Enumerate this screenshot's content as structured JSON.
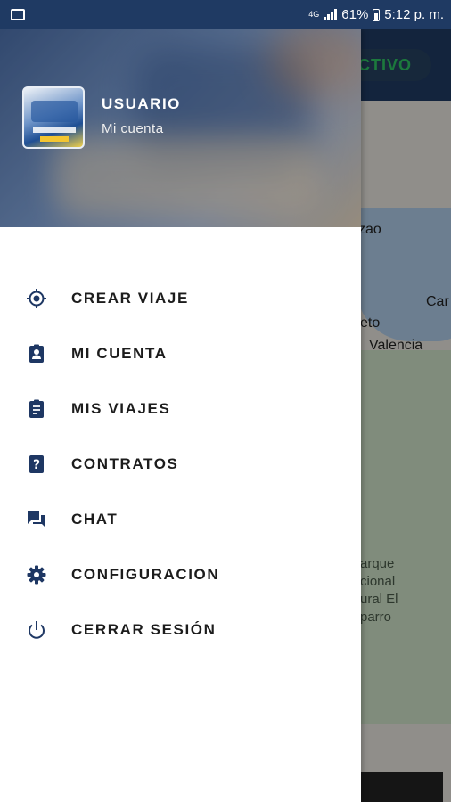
{
  "status_bar": {
    "network": "4G",
    "battery": "61%",
    "time": "5:12 p. m."
  },
  "map": {
    "status_button": "CTIVO",
    "labels": [
      "zao",
      "Car",
      "eto",
      "Valencia"
    ],
    "park_label_lines": [
      "arque",
      "cional",
      "ural El",
      "parro"
    ]
  },
  "drawer": {
    "user_name": "USUARIO",
    "user_sub": "Mi cuenta",
    "items": [
      {
        "label": "CREAR VIAJE",
        "icon": "crosshair-location-icon"
      },
      {
        "label": "MI CUENTA",
        "icon": "account-badge-icon"
      },
      {
        "label": "MIS VIAJES",
        "icon": "clipboard-list-icon"
      },
      {
        "label": "CONTRATOS",
        "icon": "help-clipboard-icon"
      },
      {
        "label": "CHAT",
        "icon": "chat-bubbles-icon"
      },
      {
        "label": "CONFIGURACION",
        "icon": "gear-icon"
      },
      {
        "label": "CERRAR SESIÓN",
        "icon": "power-icon"
      }
    ]
  },
  "colors": {
    "primary": "#1f3a63",
    "icon": "#1e3763",
    "active_green": "#2ec463"
  }
}
